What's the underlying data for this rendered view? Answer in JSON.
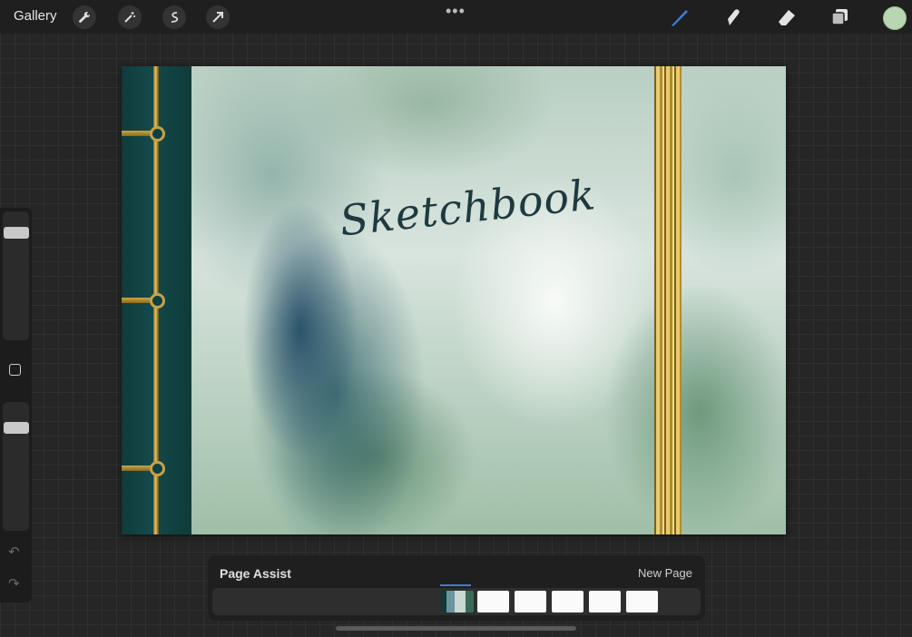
{
  "topbar": {
    "gallery_label": "Gallery",
    "tools_left": [
      "wrench-icon",
      "magic-wand-icon",
      "selection-icon",
      "transform-arrow-icon"
    ],
    "more_label": "•••",
    "tools_right": [
      "brush-icon",
      "smudge-icon",
      "eraser-icon",
      "layers-icon"
    ],
    "current_color": "#b8d6b0",
    "active_tool_color": "#3d7bd9"
  },
  "sidebar": {
    "brush_size_level": 0.87,
    "opacity_level": 0.83
  },
  "canvas": {
    "title": "Sketchbook"
  },
  "page_assist": {
    "title": "Page Assist",
    "new_page_label": "New Page",
    "pages": [
      {
        "active": true
      },
      {
        "active": false
      },
      {
        "active": false
      },
      {
        "active": false
      },
      {
        "active": false
      },
      {
        "active": false
      }
    ]
  }
}
